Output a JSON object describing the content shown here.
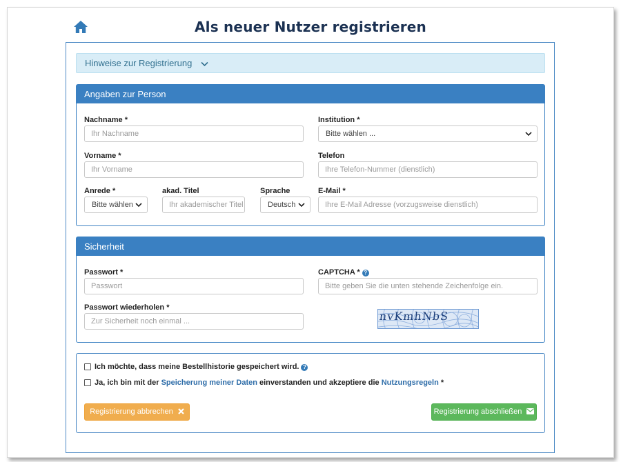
{
  "page": {
    "title": "Als neuer Nutzer registrieren"
  },
  "hint": {
    "label": "Hinweise zur Registrierung"
  },
  "person": {
    "heading": "Angaben zur Person",
    "nachname": {
      "label": "Nachname *",
      "placeholder": "Ihr Nachname",
      "value": ""
    },
    "institution": {
      "label": "Institution *",
      "selected": "Bitte wählen ..."
    },
    "vorname": {
      "label": "Vorname *",
      "placeholder": "Ihr Vorname",
      "value": ""
    },
    "telefon": {
      "label": "Telefon",
      "placeholder": "Ihre Telefon-Nummer (dienstlich)",
      "value": ""
    },
    "anrede": {
      "label": "Anrede *",
      "selected": "Bitte wählen"
    },
    "titel": {
      "label": "akad. Titel",
      "placeholder": "Ihr akademischer Titel",
      "value": ""
    },
    "sprache": {
      "label": "Sprache",
      "selected": "Deutsch"
    },
    "email": {
      "label": "E-Mail *",
      "placeholder": "Ihre E-Mail Adresse (vorzugsweise dienstlich)",
      "value": ""
    }
  },
  "security": {
    "heading": "Sicherheit",
    "passwort": {
      "label": "Passwort *",
      "placeholder": "Passwort",
      "value": ""
    },
    "captcha": {
      "label": "CAPTCHA *",
      "placeholder": "Bitte geben Sie die unten stehende Zeichenfolge ein.",
      "value": "",
      "image_text": "nvKmhNbS"
    },
    "passwort2": {
      "label": "Passwort wiederholen *",
      "placeholder": "Zur Sicherheit noch einmal ...",
      "value": ""
    }
  },
  "consent": {
    "history_label": "Ich möchte, dass meine Bestellhistorie gespeichert wird.",
    "history_checked": false,
    "terms_prefix": "Ja, ich bin mit der ",
    "terms_link1": "Speicherung meiner Daten",
    "terms_middle": " einverstanden und akzeptiere die ",
    "terms_link2": "Nutzungsregeln",
    "terms_suffix": " *",
    "terms_checked": false
  },
  "buttons": {
    "cancel": "Registrierung abbrechen",
    "submit": "Registrierung abschließen"
  },
  "icons": {
    "home": "home-icon",
    "hint_toggle": "chevron-down-icon",
    "help": "question-circle-icon",
    "cancel": "times-icon",
    "submit": "envelope-icon"
  },
  "colors": {
    "title": "#1b3152",
    "panel_header": "#3a80c2",
    "hint_bg": "#d9edf7",
    "hint_text": "#31708f",
    "cancel_button": "#f0ad4e",
    "submit_button": "#5cb85c",
    "link": "#2d6ca8"
  }
}
